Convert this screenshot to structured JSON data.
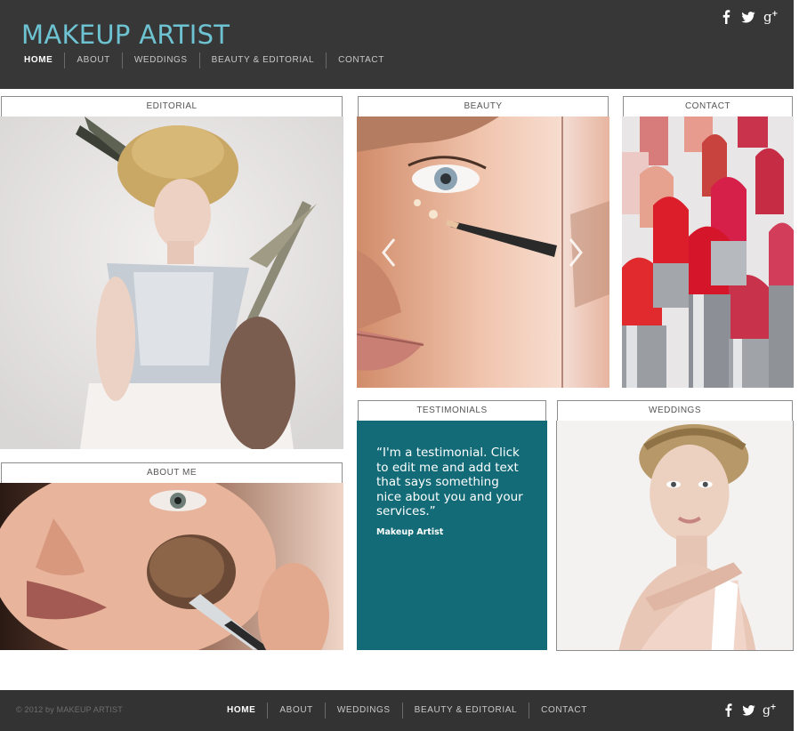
{
  "header": {
    "title": "MAKEUP ARTIST",
    "nav": [
      {
        "label": "HOME",
        "active": true
      },
      {
        "label": "ABOUT",
        "active": false
      },
      {
        "label": "WEDDINGS",
        "active": false
      },
      {
        "label": "BEAUTY & EDITORIAL",
        "active": false
      },
      {
        "label": "CONTACT",
        "active": false
      }
    ],
    "social_icons": [
      "facebook-icon",
      "twitter-icon",
      "google-plus-icon"
    ]
  },
  "tiles": {
    "editorial": {
      "label": "EDITORIAL"
    },
    "beauty": {
      "label": "BEAUTY"
    },
    "contact": {
      "label": "CONTACT"
    },
    "about_me": {
      "label": "ABOUT ME"
    },
    "testimonials": {
      "label": "TESTIMONIALS"
    },
    "weddings": {
      "label": "WEDDINGS"
    }
  },
  "testimonial": {
    "quote": "“I'm a testimonial. Click to edit me and add text that says something nice about you and your services.”",
    "author": "Makeup Artist"
  },
  "footer": {
    "copyright": "© 2012 by MAKEUP ARTIST",
    "nav": [
      {
        "label": "HOME",
        "active": true
      },
      {
        "label": "ABOUT",
        "active": false
      },
      {
        "label": "WEDDINGS",
        "active": false
      },
      {
        "label": "BEAUTY & EDITORIAL",
        "active": false
      },
      {
        "label": "CONTACT",
        "active": false
      }
    ]
  },
  "colors": {
    "header_bg": "#373737",
    "title": "#6ec3d2",
    "testimonial_bg": "#136b78",
    "footer_bg": "#333333"
  }
}
